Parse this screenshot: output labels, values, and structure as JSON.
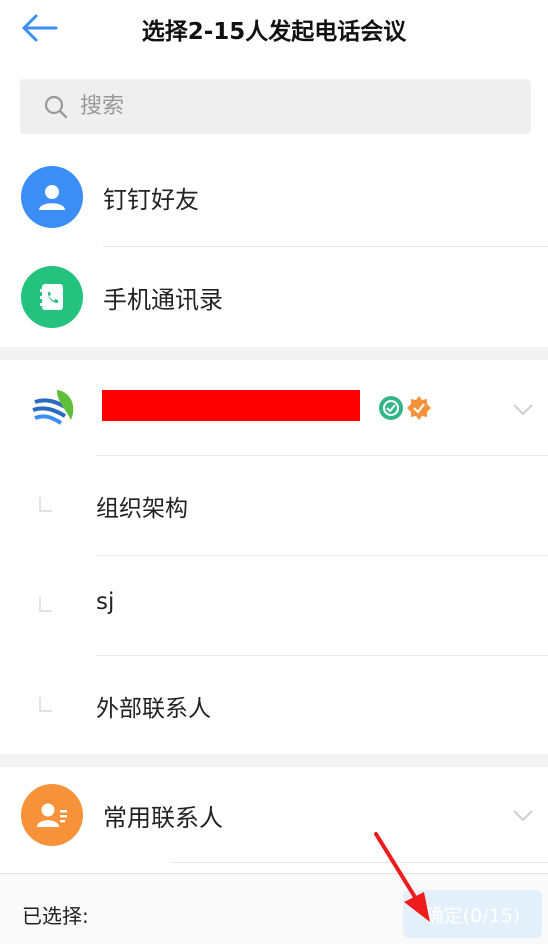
{
  "header": {
    "title": "选择2-15人发起电话会议",
    "back_icon": "arrow-left-icon"
  },
  "search": {
    "placeholder": "搜索",
    "value": ""
  },
  "entries": [
    {
      "label": "钉钉好友",
      "icon": "person-icon",
      "color": "#3a8ef6"
    },
    {
      "label": "手机通讯录",
      "icon": "phone-book-icon",
      "color": "#24c27e"
    }
  ],
  "org": {
    "logo_icon": "leaf-logo-icon",
    "badges": [
      "verified-shield-icon",
      "certified-star-icon"
    ],
    "children": [
      {
        "label": "组织架构"
      },
      {
        "label": "sj"
      },
      {
        "label": "外部联系人"
      }
    ]
  },
  "frequent": {
    "label": "常用联系人",
    "icon": "contact-card-icon",
    "color": "#f5923a"
  },
  "footer": {
    "selected_label": "已选择:",
    "confirm_label": "确定(0/15)"
  },
  "colors": {
    "accent": "#3a8ef6",
    "confirm_bg": "#e3effa",
    "redaction": "#ff0000"
  }
}
